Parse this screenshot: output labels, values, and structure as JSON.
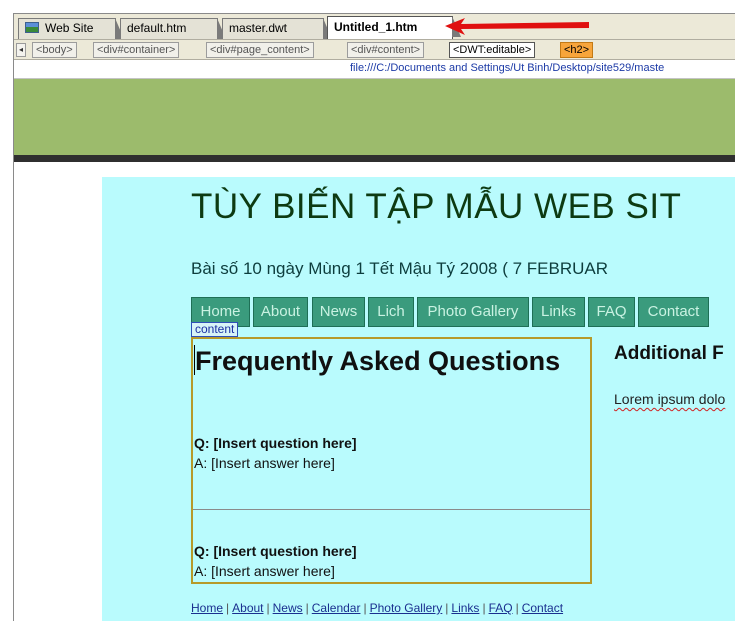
{
  "tabs": [
    {
      "label": "Web Site",
      "icon": "site-icon"
    },
    {
      "label": "default.htm"
    },
    {
      "label": "master.dwt"
    },
    {
      "label": "Untitled_1.htm",
      "active": true
    }
  ],
  "tag_selector": [
    "<body>",
    "<div#container>",
    "<div#page_content>",
    "<div#content>",
    "<DWT:editable>",
    "<h2>"
  ],
  "path": "file:///C:/Documents and Settings/Ut Binh/Desktop/site529/maste",
  "page": {
    "site_title": "TÙY BIẾN TẬP MẪU WEB SIT",
    "subtitle": "Bài số 10 ngày Mùng 1 Tết Mậu Tý 2008 ( 7 FEBRUAR",
    "nav": [
      "Home",
      "About",
      "News",
      "Lich",
      "Photo Gallery",
      "Links",
      "FAQ",
      "Contact"
    ],
    "content_label": "content",
    "faq_title": "Frequently Asked Questions",
    "faq": [
      {
        "q": "Q: [Insert question here]",
        "a": "A: [Insert answer here]"
      },
      {
        "q": "Q: [Insert question here]",
        "a": "A: [Insert answer here]"
      }
    ],
    "side_title": "Additional F",
    "side_text": "Lorem ipsum dolo",
    "footer_links": [
      "Home",
      "About",
      "News",
      "Calendar",
      "Photo Gallery",
      "Links",
      "FAQ",
      "Contact"
    ]
  },
  "colors": {
    "green_band": "#9cbb6c",
    "container_bg": "#b9fbfd",
    "nav_bg": "#3a9b7d",
    "selected_tag": "#f7a53b",
    "arrow": "#e01010"
  }
}
